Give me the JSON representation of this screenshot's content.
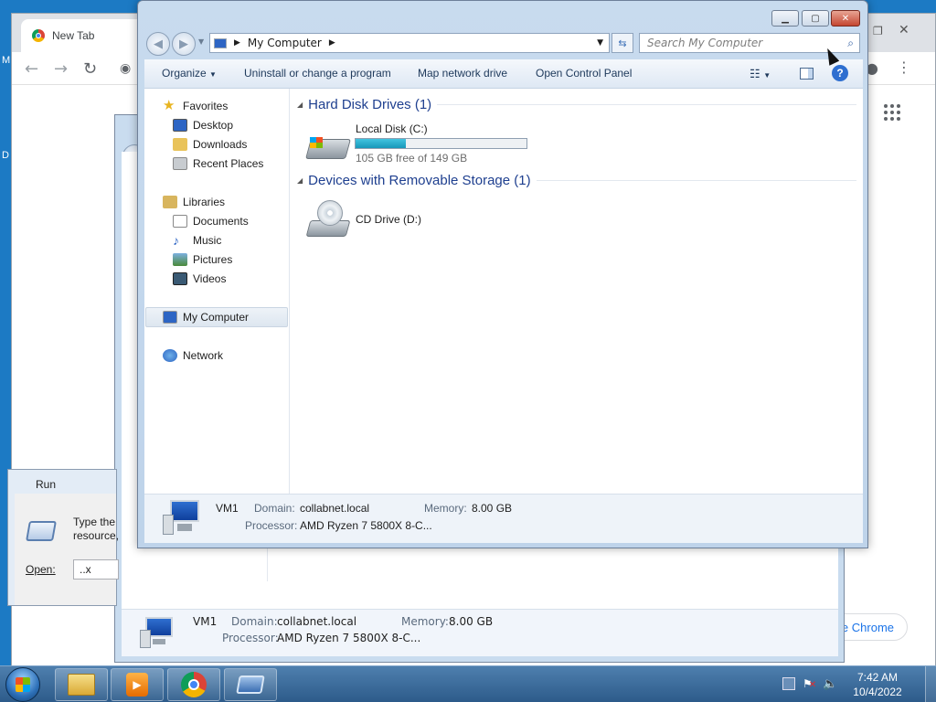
{
  "desktop": {
    "edge_label_top": "M",
    "edge_label_mid": "D"
  },
  "chrome": {
    "tab_title": "New Tab",
    "set_default_partial": "e Chrome"
  },
  "back_explorer": {
    "details": {
      "name": "VM1",
      "domain_key": "Domain:",
      "domain_val": "collabnet.local",
      "memory_key": "Memory:",
      "memory_val": "8.00 GB",
      "processor_key": "Processor:",
      "processor_val": "AMD Ryzen 7 5800X 8-C..."
    }
  },
  "run_dialog": {
    "title": "Run",
    "desc_line1": "Type the",
    "desc_line2": "resource,",
    "open_label": "Open:",
    "open_value": "..x"
  },
  "explorer": {
    "address": {
      "path_item": "My Computer"
    },
    "search": {
      "placeholder": "Search My Computer"
    },
    "commands": {
      "organize": "Organize",
      "uninstall": "Uninstall or change a program",
      "map_drive": "Map network drive",
      "control_panel": "Open Control Panel"
    },
    "nav": {
      "favorites": "Favorites",
      "desktop": "Desktop",
      "downloads": "Downloads",
      "recent": "Recent Places",
      "libraries": "Libraries",
      "documents": "Documents",
      "music": "Music",
      "pictures": "Pictures",
      "videos": "Videos",
      "computer": "My Computer",
      "network": "Network"
    },
    "groups": {
      "hdd": "Hard Disk Drives (1)",
      "removable": "Devices with Removable Storage (1)"
    },
    "drives": {
      "c_name": "Local Disk (C:)",
      "c_free": "105 GB free of 149 GB",
      "c_used_fraction": 0.295,
      "d_name": "CD Drive (D:)"
    },
    "details": {
      "name": "VM1",
      "domain_key": "Domain:",
      "domain_val": "collabnet.local",
      "memory_key": "Memory:",
      "memory_val": "8.00 GB",
      "processor_key": "Processor:",
      "processor_val": "AMD Ryzen 7 5800X 8-C..."
    }
  },
  "taskbar": {
    "time": "7:42 AM",
    "date": "10/4/2022"
  },
  "colors": {
    "accent": "#1e3f8f",
    "disk_fill": "#1798b9",
    "taskbar": "#2d5b8a"
  }
}
